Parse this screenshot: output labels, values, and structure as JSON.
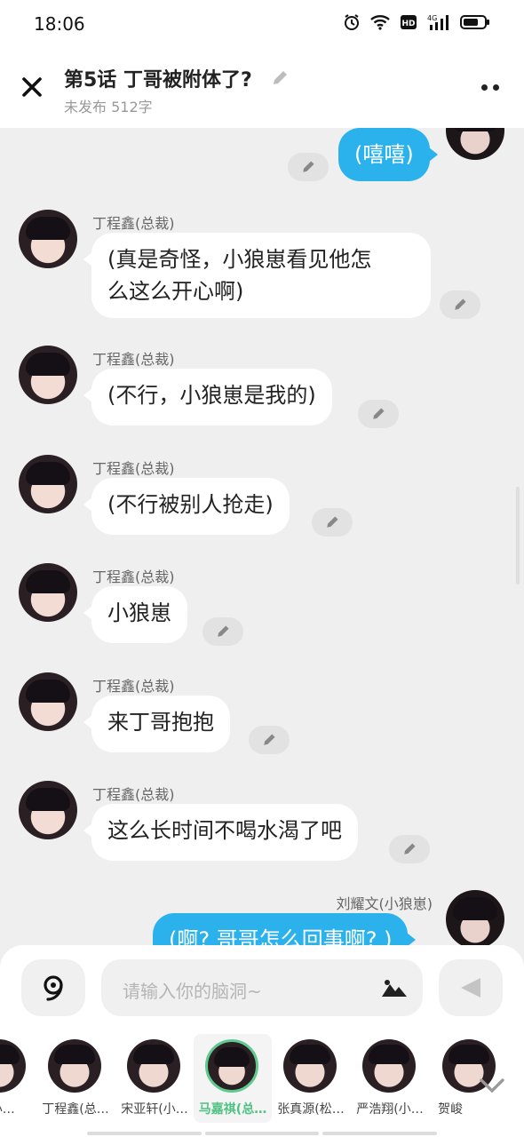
{
  "status_bar": {
    "time": "18:06",
    "icons": [
      "alarm-icon",
      "wifi-icon",
      "hd-icon",
      "signal-4g-icon",
      "battery-icon"
    ],
    "hd_label": "HD",
    "net_label": "4G"
  },
  "header": {
    "title": "第5话  丁哥被附体了?",
    "subtitle": "未发布 512字"
  },
  "messages": [
    {
      "side": "right",
      "name": "",
      "text": "(嘻嘻)",
      "style": "blue"
    },
    {
      "side": "left",
      "name": "丁程鑫(总裁)",
      "text_lines": [
        "(真是奇怪，小狼崽看见他怎",
        "么这么开心啊)"
      ]
    },
    {
      "side": "left",
      "name": "丁程鑫(总裁)",
      "text": "(不行，小狼崽是我的)"
    },
    {
      "side": "left",
      "name": "丁程鑫(总裁)",
      "text": "(不行被别人抢走)"
    },
    {
      "side": "left",
      "name": "丁程鑫(总裁)",
      "text": "小狼崽"
    },
    {
      "side": "left",
      "name": "丁程鑫(总裁)",
      "text": "来丁哥抱抱"
    },
    {
      "side": "left",
      "name": "丁程鑫(总裁)",
      "text": "这么长时间不喝水渴了吧"
    },
    {
      "side": "right",
      "name": "刘耀文(小狼崽)",
      "text": "(啊? 哥哥怎么回事啊? )",
      "style": "blue"
    }
  ],
  "input": {
    "placeholder": "请输入你的脑洞~"
  },
  "characters": [
    {
      "label": "(小…",
      "selected": false
    },
    {
      "label": "丁程鑫(总…",
      "selected": false
    },
    {
      "label": "宋亚轩(小…",
      "selected": false
    },
    {
      "label": "马嘉祺(总…",
      "selected": true
    },
    {
      "label": "张真源(松…",
      "selected": false
    },
    {
      "label": "严浩翔(小…",
      "selected": false
    },
    {
      "label": "贺峻",
      "selected": false
    }
  ],
  "colors": {
    "accent_blue": "#2bb2ec",
    "selected_green": "#4fc283",
    "background": "#efefef"
  }
}
